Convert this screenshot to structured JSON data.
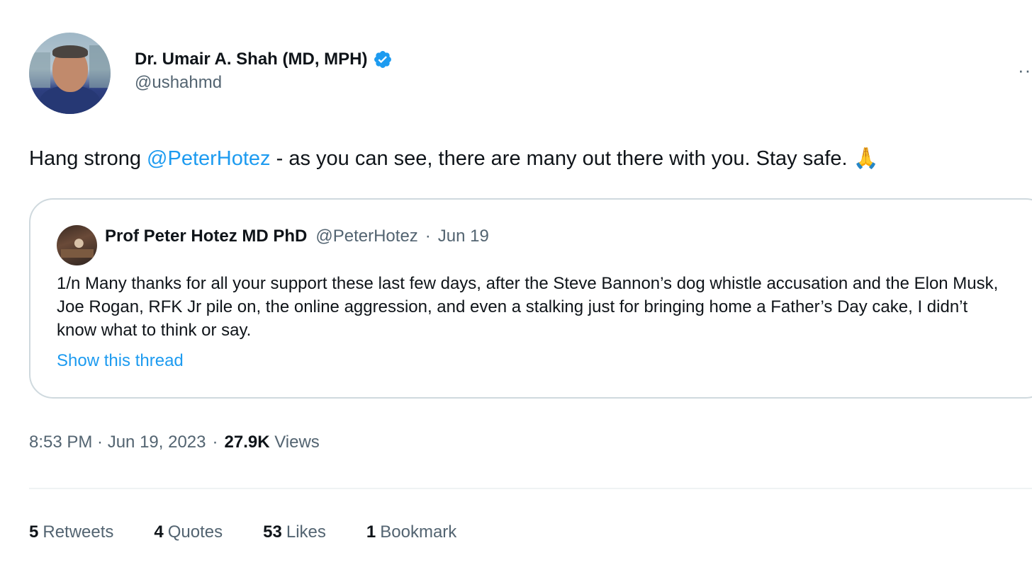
{
  "author": {
    "display_name": "Dr. Umair A. Shah (MD, MPH)",
    "handle": "@ushahmd",
    "verified": true
  },
  "more_menu": "··",
  "tweet": {
    "text_before": "Hang strong ",
    "mention": "@PeterHotez",
    "text_after": "  - as you can see, there are many out there with you. Stay safe. 🙏"
  },
  "quoted_tweet": {
    "author_name": "Prof Peter Hotez MD PhD",
    "author_handle": "@PeterHotez",
    "separator": "·",
    "date": "Jun 19",
    "text": "1/n Many thanks for all your support these last few days, after the Steve Bannon’s dog whistle accusation and the Elon Musk, Joe Rogan, RFK Jr pile on, the online aggression, and even a stalking just for bringing home a Father’s Day cake, I didn’t know what to think or say.",
    "show_thread_label": "Show this thread"
  },
  "meta": {
    "time_date": "8:53 PM · Jun 19, 2023",
    "separator": "·",
    "views_count": "27.9K",
    "views_label": "Views"
  },
  "stats": [
    {
      "count": "5",
      "label": "Retweets"
    },
    {
      "count": "4",
      "label": "Quotes"
    },
    {
      "count": "53",
      "label": "Likes"
    },
    {
      "count": "1",
      "label": "Bookmark"
    }
  ],
  "colors": {
    "link": "#1d9bf0",
    "secondary_text": "#536471",
    "primary_text": "#0f1419",
    "border": "#cfd9de"
  }
}
